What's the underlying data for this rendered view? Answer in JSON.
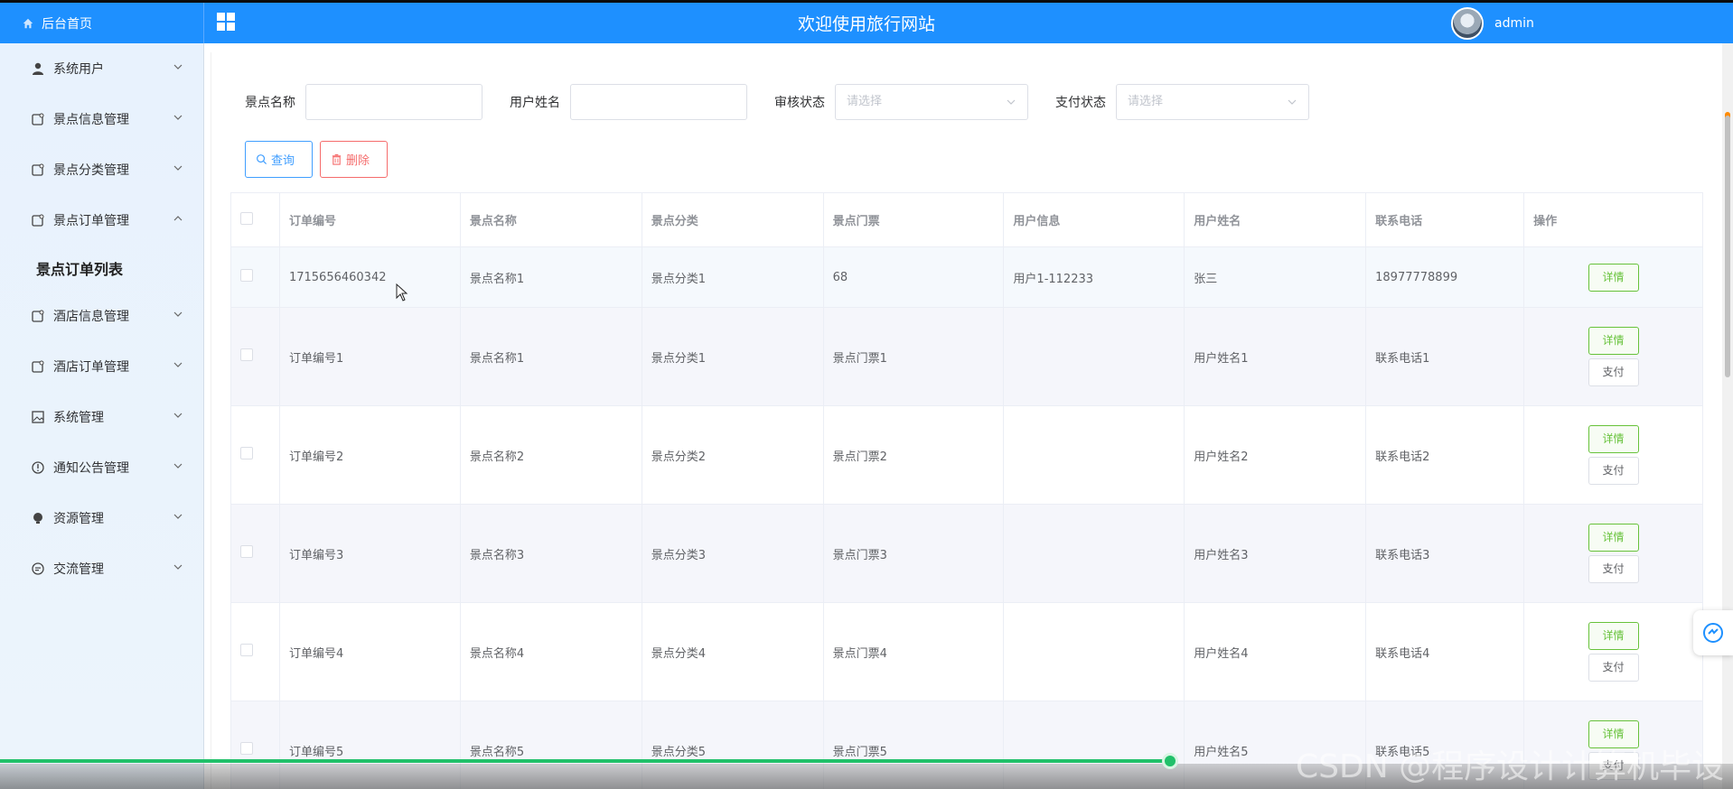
{
  "header": {
    "brand": "后台首页",
    "title": "欢迎使用旅行网站",
    "user": "admin"
  },
  "sidebar": {
    "items": [
      {
        "label": "系统用户",
        "icon": "user-icon",
        "expanded": false
      },
      {
        "label": "景点信息管理",
        "icon": "ticket-icon",
        "expanded": false
      },
      {
        "label": "景点分类管理",
        "icon": "ticket-icon",
        "expanded": false
      },
      {
        "label": "景点订单管理",
        "icon": "ticket-icon",
        "expanded": true
      },
      {
        "label": "酒店信息管理",
        "icon": "ticket-icon",
        "expanded": false
      },
      {
        "label": "酒店订单管理",
        "icon": "ticket-icon",
        "expanded": false
      },
      {
        "label": "系统管理",
        "icon": "image-icon",
        "expanded": false
      },
      {
        "label": "通知公告管理",
        "icon": "info-icon",
        "expanded": false
      },
      {
        "label": "资源管理",
        "icon": "bulb-icon",
        "expanded": false
      },
      {
        "label": "交流管理",
        "icon": "chat-icon",
        "expanded": false
      }
    ],
    "submenu": "景点订单列表"
  },
  "filters": {
    "scenic_name_label": "景点名称",
    "user_name_label": "用户姓名",
    "audit_label": "审核状态",
    "pay_label": "支付状态",
    "select_placeholder": "请选择"
  },
  "buttons": {
    "query": "查询",
    "delete": "删除"
  },
  "table": {
    "columns": [
      "订单编号",
      "景点名称",
      "景点分类",
      "景点门票",
      "用户信息",
      "用户姓名",
      "联系电话",
      "操作"
    ],
    "rows": [
      [
        "1715656460342",
        "景点名称1",
        "景点分类1",
        "68",
        "用户1-112233",
        "张三",
        "18977778899"
      ],
      [
        "订单编号1",
        "景点名称1",
        "景点分类1",
        "景点门票1",
        "",
        "用户姓名1",
        "联系电话1"
      ],
      [
        "订单编号2",
        "景点名称2",
        "景点分类2",
        "景点门票2",
        "",
        "用户姓名2",
        "联系电话2"
      ],
      [
        "订单编号3",
        "景点名称3",
        "景点分类3",
        "景点门票3",
        "",
        "用户姓名3",
        "联系电话3"
      ],
      [
        "订单编号4",
        "景点名称4",
        "景点分类4",
        "景点门票4",
        "",
        "用户姓名4",
        "联系电话4"
      ],
      [
        "订单编号5",
        "景点名称5",
        "景点分类5",
        "景点门票5",
        "",
        "用户姓名5",
        "联系电话5"
      ]
    ],
    "detail_label": "详情",
    "pay_label": "支付"
  },
  "player": {
    "progress": 0.675
  },
  "watermark": "CSDN @程序设计计算机毕设",
  "colors": {
    "header": "#1e90ff",
    "primary": "#409eff",
    "danger": "#f56c6c",
    "success": "#67c23a",
    "progress": "#21c06a"
  }
}
